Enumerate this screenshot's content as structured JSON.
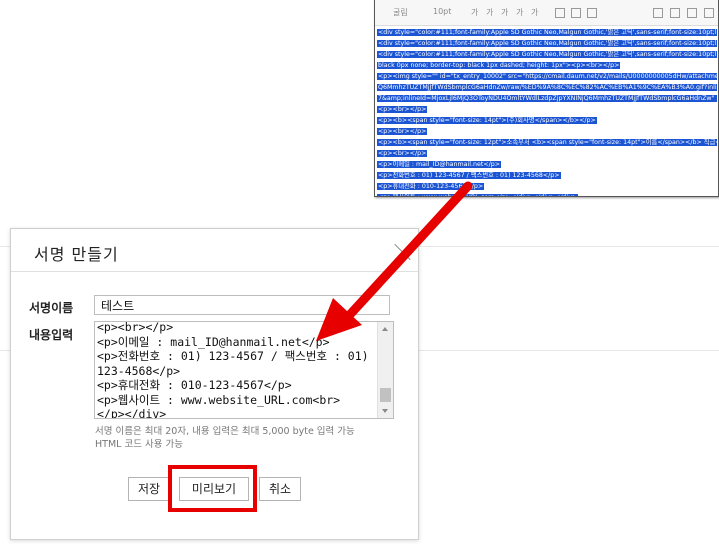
{
  "code_window": {
    "toolbar": {
      "font_family": "굴림",
      "font_size": "10pt",
      "buttons": [
        "가",
        "가",
        "가",
        "가",
        "가"
      ]
    },
    "code_lines": [
      "<div style=\"color:#111;font-family:Apple SD Gothic Neo,Malgun Gothic,'맑은 고딕',sans-serif;font-size:10pt;line-height:1.5;\">",
      "<div style=\"color:#111;font-family:Apple SD Gothic Neo,Malgun Gothic,'맑은 고딕',sans-serif;font-size:10pt;line-height:1.5",
      "<div style=\"color:#111;font-family:Apple SD Gothic Neo,Malgun Gothic,'맑은 고딕',sans-serif;font-size:10pt;line-height",
      "black 0px none; border-top: black 1px dashed; height: 1px\"><p><br></p>",
      "<p><img style=\"\" id=\"tx_entry_10002\" src=\"https://cmail.daum.net/v2/mails/U0000000005dHw/attachments/MjoxLjl6MjQ",
      "Q6MmhzTUZTMjJfTWdSbmplcG6aHdnZw/raw/%ED%9A%8C%EC%82%AC%EB%A1%9C%EA%B3%A0.gif?inlineContent=yes",
      "7&amp;inlineId=MjoxLjl6MjQ3OToyNDU4OmltYWdlLzdpZjpYXNINjQ6MmhzTUZTMjJfTWdSbmplcG6aHdnZw\" inlineId=\"",
      "<p><br></p>",
      "<p><b><span style=\"font-size: 14pt\">(주)회사명</span></b></p>",
      "<p><br></p>",
      "<p><b><span style=\"font-size: 12pt\">소속부서 <b><span style=\"font-size: 14pt\">이름</span></b> 직급</span></p>",
      "<p><br></p>",
      "<p>이메일 : mail_ID@hanmail.net</p>",
      "<p>전화번호 : 01) 123-4567 / 팩스번호 : 01) 123-4568</p>",
      "<p>휴대전화 : 010-123-4567</p>",
      "<p>웹사이트 : www.website_URL.com</p></div></div></div>"
    ]
  },
  "dialog": {
    "title": "서명 만들기",
    "name_label": "서명이름",
    "name_value": "테스트",
    "content_label": "내용입력",
    "content_text": "<p><br></p>\n<p>이메일 : mail_ID@hanmail.net</p>\n<p>전화번호 : 01) 123-4567 / 팩스번호 : 01) 123-4568</p>\n<p>휴대전화 : 010-123-4567</p>\n<p>웹사이트 : www.website_URL.com<br>\n</p></div>",
    "help_text": "서명 이름은 최대 20자, 내용 입력은 최대 5,000 byte 입력 가능\nHTML 코드 사용 가능",
    "buttons": {
      "save": "저장",
      "preview": "미리보기",
      "cancel": "취소"
    }
  },
  "colors": {
    "highlight_blue": "#1c55d4",
    "annotation_red": "#e60000"
  }
}
